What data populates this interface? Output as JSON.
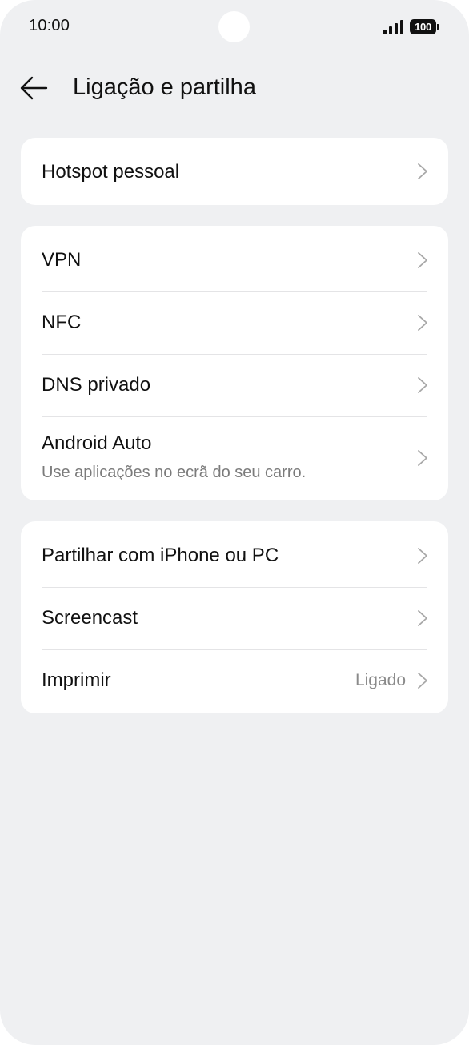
{
  "status_bar": {
    "time": "10:00",
    "battery": "100",
    "icons": [
      "signal-icon",
      "battery-icon"
    ]
  },
  "header": {
    "back_icon": "back-arrow-icon",
    "title": "Ligação e partilha"
  },
  "groups": [
    {
      "items": [
        {
          "label": "Hotspot pessoal"
        }
      ]
    },
    {
      "items": [
        {
          "label": "VPN"
        },
        {
          "label": "NFC"
        },
        {
          "label": "DNS privado"
        },
        {
          "label": "Android Auto",
          "subtitle": "Use aplicações no ecrã do seu carro."
        }
      ]
    },
    {
      "items": [
        {
          "label": "Partilhar com iPhone ou PC"
        },
        {
          "label": "Screencast"
        },
        {
          "label": "Imprimir",
          "value": "Ligado"
        }
      ]
    }
  ],
  "colors": {
    "background": "#eff0f2",
    "card": "#ffffff",
    "text": "#111111",
    "secondary_text": "#7b7b7b",
    "chevron": "#a8a8a8"
  }
}
